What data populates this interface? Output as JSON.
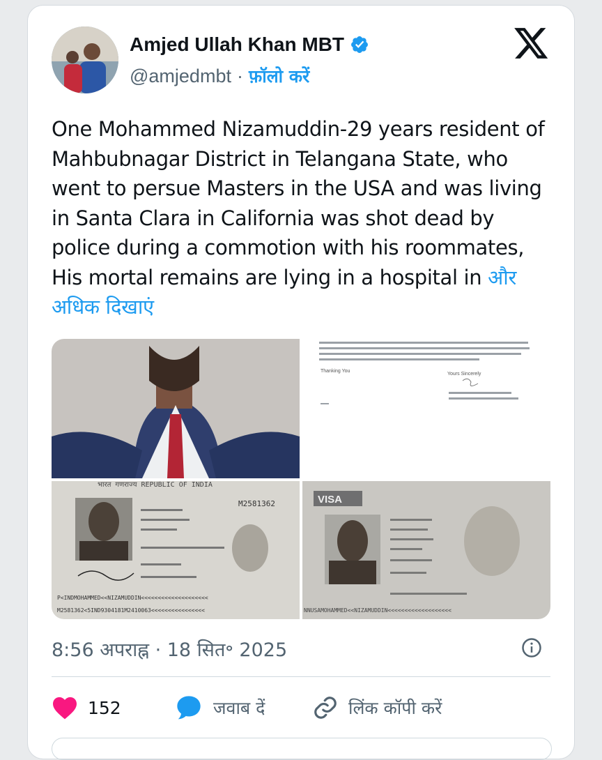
{
  "author": {
    "name": "Amjed Ullah Khan MBT",
    "handle": "@amjedmbt",
    "separator": "·",
    "follow_label": "फ़ॉलो करें"
  },
  "tweet": {
    "text": "One Mohammed Nizamuddin-29 years resident of Mahbubnagar District in Telangana State, who went to persue Masters in the USA and was living in Santa Clara in California was shot dead by police during a commotion with his roommates, His mortal remains are lying in a hospital in",
    "show_more": "और अधिक दिखाएं"
  },
  "media": {
    "passport_header": "भारत गणराज्य REPUBLIC OF INDIA",
    "passport_number": "M2581362",
    "passport_mrz_1": "P<INDMOHAMMED<<NIZAMUDDIN<<<<<<<<<<<<<<<<<<<<",
    "passport_mrz_2": "M2581362<5IND9304181M2410063<<<<<<<<<<<<<<<<",
    "visa_label": "VISA",
    "visa_mrz": "NNUSAMOHAMMED<<NIZAMUDDIN<<<<<<<<<<<<<<<<<<<",
    "letter_signoff": "Thanking You",
    "letter_closing": "Yours Sincerely"
  },
  "meta": {
    "timestamp": "8:56 अपराह्न · 18 सित॰ 2025"
  },
  "actions": {
    "likes": "152",
    "reply_label": "जवाब दें",
    "copy_label": "लिंक कॉपी करें"
  },
  "colors": {
    "accent": "#1d9bf0",
    "like": "#f91880",
    "text": "#0f1419",
    "muted": "#536471"
  }
}
